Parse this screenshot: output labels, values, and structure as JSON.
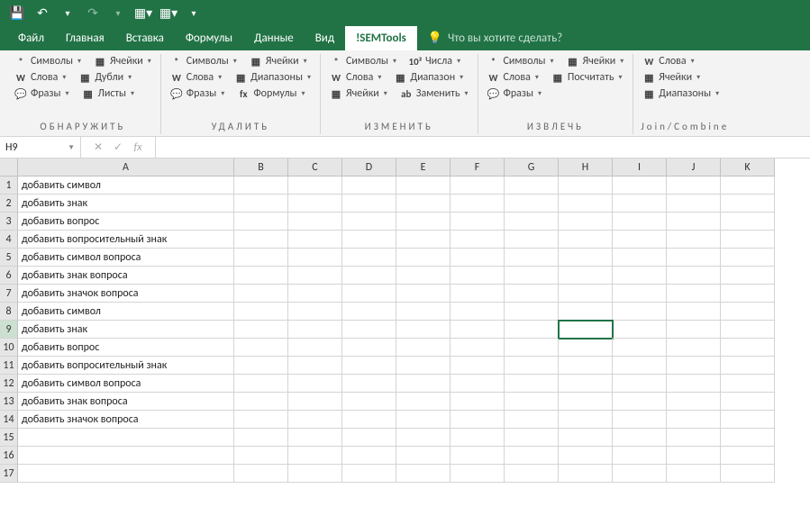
{
  "qat": {
    "save": "💾",
    "undo": "↶",
    "redo": "↷"
  },
  "tabs": [
    "Файл",
    "Главная",
    "Вставка",
    "Формулы",
    "Данные",
    "Вид",
    "!SEMTools"
  ],
  "activeTab": "!SEMTools",
  "tellMe": "Что вы хотите сделать?",
  "ribbon": {
    "group1": {
      "label": "ОБНАРУЖИТЬ",
      "r1": [
        {
          "icon": "*",
          "t": "Символы"
        },
        {
          "icon": "▦",
          "t": "Ячейки"
        }
      ],
      "r2": [
        {
          "icon": "W",
          "t": "Слова"
        },
        {
          "icon": "▦",
          "t": "Дубли"
        }
      ],
      "r3": [
        {
          "icon": "💬",
          "t": "Фразы"
        },
        {
          "icon": "▦",
          "t": "Листы"
        }
      ]
    },
    "group2": {
      "label": "УДАЛИТЬ",
      "r1": [
        {
          "icon": "*",
          "t": "Символы"
        },
        {
          "icon": "▦",
          "t": "Ячейки"
        }
      ],
      "r2": [
        {
          "icon": "W",
          "t": "Слова"
        },
        {
          "icon": "▦",
          "t": "Диапазоны"
        }
      ],
      "r3": [
        {
          "icon": "💬",
          "t": "Фразы"
        },
        {
          "icon": "fx",
          "t": "Формулы"
        }
      ]
    },
    "group3": {
      "label": "ИЗМЕНИТЬ",
      "r1": [
        {
          "icon": "*",
          "t": "Символы"
        },
        {
          "icon": "10²",
          "t": "Числа"
        }
      ],
      "r2": [
        {
          "icon": "W",
          "t": "Слова"
        },
        {
          "icon": "▦",
          "t": "Диапазон"
        }
      ],
      "r3": [
        {
          "icon": "▦",
          "t": "Ячейки"
        },
        {
          "icon": "ab",
          "t": "Заменить"
        }
      ]
    },
    "group4": {
      "label": "ИЗВЛЕЧЬ",
      "r1": [
        {
          "icon": "*",
          "t": "Символы"
        },
        {
          "icon": "▦",
          "t": "Ячейки"
        }
      ],
      "r2": [
        {
          "icon": "W",
          "t": "Слова"
        },
        {
          "icon": "▦",
          "t": "Посчитать"
        }
      ],
      "r3": [
        {
          "icon": "💬",
          "t": "Фразы"
        }
      ]
    },
    "group5": {
      "label": "Join/Combine",
      "r1": [
        {
          "icon": "W",
          "t": "Слова"
        }
      ],
      "r2": [
        {
          "icon": "▦",
          "t": "Ячейки"
        }
      ],
      "r3": [
        {
          "icon": "▦",
          "t": "Диапазоны"
        }
      ]
    }
  },
  "namebox": "H9",
  "cols": [
    "A",
    "B",
    "C",
    "D",
    "E",
    "F",
    "G",
    "H",
    "I",
    "J",
    "K"
  ],
  "rows": [
    {
      "n": 1,
      "a": "добавить символ"
    },
    {
      "n": 2,
      "a": "добавить знак"
    },
    {
      "n": 3,
      "a": "добавить вопрос"
    },
    {
      "n": 4,
      "a": "добавить вопросительный знак"
    },
    {
      "n": 5,
      "a": "добавить символ вопроса"
    },
    {
      "n": 6,
      "a": "добавить знак вопроса"
    },
    {
      "n": 7,
      "a": "добавить значок вопроса"
    },
    {
      "n": 8,
      "a": "добавить символ"
    },
    {
      "n": 9,
      "a": "добавить знак"
    },
    {
      "n": 10,
      "a": "добавить вопрос"
    },
    {
      "n": 11,
      "a": "добавить вопросительный знак"
    },
    {
      "n": 12,
      "a": "добавить символ вопроса"
    },
    {
      "n": 13,
      "a": "добавить знак вопроса"
    },
    {
      "n": 14,
      "a": "добавить значок вопроса"
    },
    {
      "n": 15,
      "a": ""
    },
    {
      "n": 16,
      "a": ""
    },
    {
      "n": 17,
      "a": ""
    }
  ],
  "selected": {
    "row": 9,
    "col": "H"
  }
}
